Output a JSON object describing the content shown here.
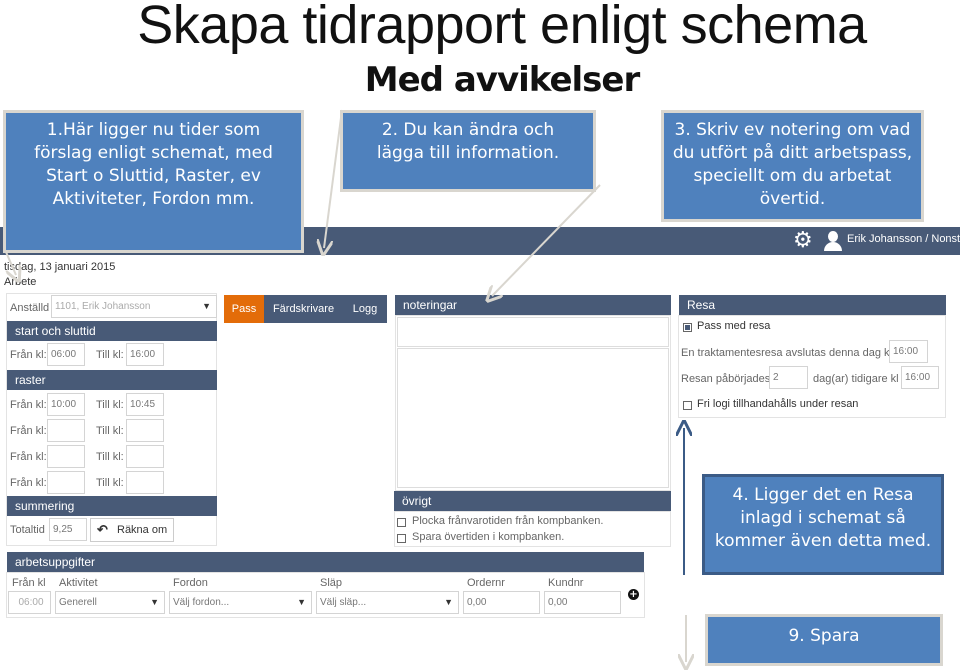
{
  "slide": {
    "title": "Skapa tidrapport enligt schema",
    "subtitle": "Med avvikelser"
  },
  "callouts": {
    "c1": "1.Här ligger nu tider som förslag enligt schemat, med Start o Sluttid, Raster, ev Aktiviteter, Fordon mm.",
    "c2": "2. Du kan ändra och lägga till information.",
    "c3": "3. Skriv ev notering om vad du utfört på ditt arbetspass, speciellt om du arbetat övertid.",
    "c4": "4. Ligger det en Resa inlagd i schemat så kommer även detta med.",
    "c9": "9. Spara"
  },
  "topbar": {
    "settings_icon": "gear-icon",
    "user_icon": "user-icon",
    "user_label": "Erik Johansson / Nonst"
  },
  "header": {
    "date": "tisdag, 13 januari 2015",
    "type": "Arbete"
  },
  "employee": {
    "label": "Anställd",
    "value": "1101, Erik  Johansson"
  },
  "start_end": {
    "title": "start och sluttid",
    "from_label": "Från kl:",
    "from_value": "06:00",
    "to_label": "Till kl:",
    "to_value": "16:00"
  },
  "breaks": {
    "title": "raster",
    "from_label": "Från kl:",
    "to_label": "Till kl:",
    "rows": [
      {
        "from": "10:00",
        "to": "10:45"
      },
      {
        "from": "",
        "to": ""
      },
      {
        "from": "",
        "to": ""
      },
      {
        "from": "",
        "to": ""
      }
    ]
  },
  "summary": {
    "title": "summering",
    "total_label": "Totaltid",
    "total_value": "9,25",
    "recalc_label": "Räkna om"
  },
  "tabs": [
    {
      "label": "Pass",
      "active": true
    },
    {
      "label": "Färdskrivare",
      "active": false
    },
    {
      "label": "Logg",
      "active": false
    }
  ],
  "notes": {
    "title": "noteringar",
    "value": ""
  },
  "other": {
    "title": "övrigt",
    "options": [
      {
        "label": "Plocka frånvarotiden från kompbanken.",
        "checked": false
      },
      {
        "label": "Spara övertiden i kompbanken.",
        "checked": false
      }
    ]
  },
  "travel": {
    "title": "Resa",
    "trip_label": "Pass med resa",
    "trip_checked": true,
    "ends_label": "En traktamentesresa avslutas denna dag kl",
    "ends_value": "16:00",
    "started_label": "Resan påbörjades",
    "started_days": "2",
    "days_label": "dag(ar) tidigare kl",
    "started_time": "16:00",
    "lodging_label": "Fri logi tillhandahålls under resan",
    "lodging_checked": false
  },
  "tasks": {
    "title": "arbetsuppgifter",
    "columns": [
      "Från kl",
      "Aktivitet",
      "Fordon",
      "Släp",
      "Ordernr",
      "Kundnr"
    ],
    "row": {
      "from": "06:00",
      "activity": "Generell",
      "vehicle_placeholder": "Välj fordon...",
      "trailer_placeholder": "Välj släp...",
      "order": "0,00",
      "customer": "0,00"
    },
    "add_icon": "plus-circle-icon"
  },
  "colors": {
    "header_bar": "#485a77",
    "active_tab": "#e36c09",
    "callout": "#4f81bd"
  }
}
